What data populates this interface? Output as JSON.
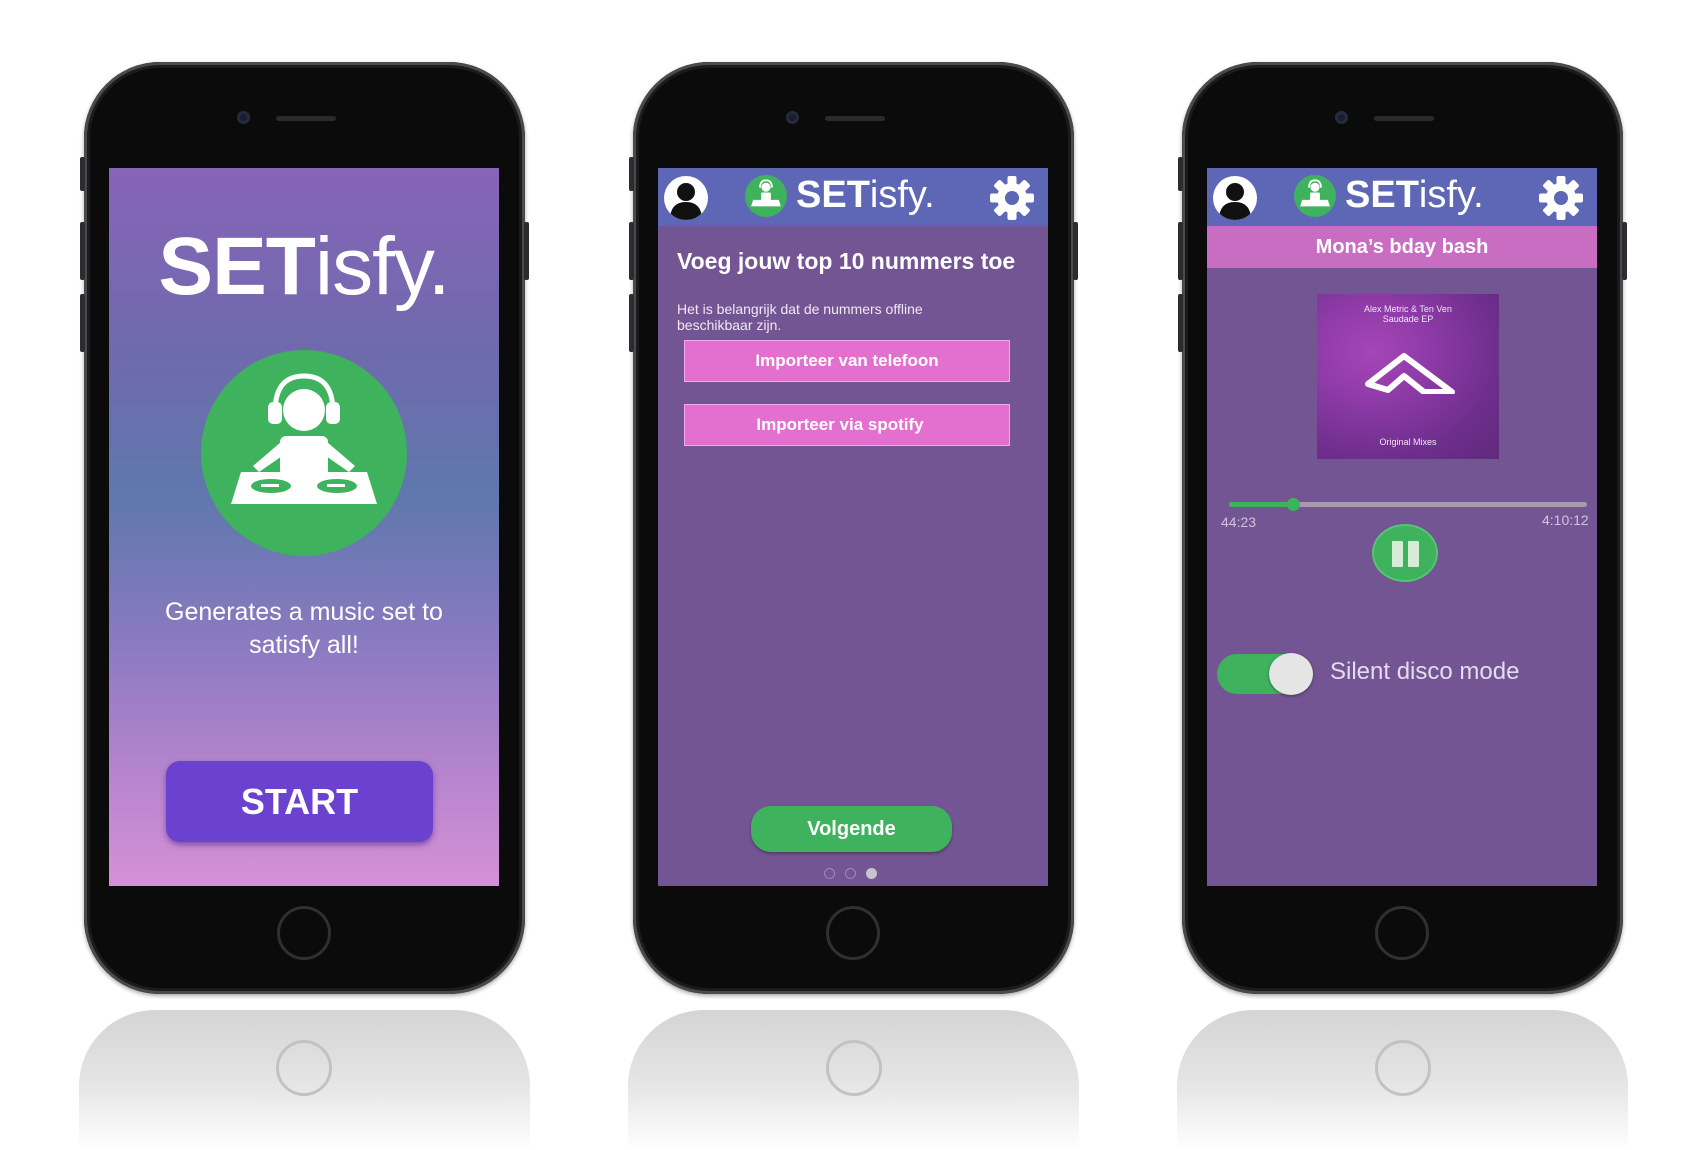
{
  "screen1": {
    "logo_bold": "SET",
    "logo_rest": "isfy.",
    "tagline_line1": "Generates a music set to",
    "tagline_line2": "satisfy all!",
    "start_label": "START"
  },
  "header": {
    "title_bold": "SET",
    "title_rest": "isfy."
  },
  "screen2": {
    "title": "Voeg jouw top 10 nummers toe",
    "subtitle": "Het is belangrijk dat de nummers offline beschikbaar zijn.",
    "import_phone_label": "Importeer van telefoon",
    "import_spotify_label": "Importeer via spotify",
    "next_label": "Volgende",
    "pager": {
      "total": 3,
      "active": 3
    }
  },
  "screen3": {
    "party_name": "Mona’s bday bash",
    "album": {
      "artist_line1": "Alex Metric & Ten Ven",
      "artist_line2": "Saudade EP",
      "footer": "Original Mixes"
    },
    "elapsed": "44:23",
    "total": "4:10:12",
    "progress_fraction": 0.18,
    "silent_disco_label": "Silent disco mode",
    "silent_disco_on": true
  },
  "colors": {
    "green": "#3fb25e",
    "purple": "#735594",
    "header_blue": "#5d67b5",
    "pink_button": "#e36fcf",
    "start_button": "#6a42cf",
    "party_bar": "#c86dc2"
  },
  "icons": [
    "dj-icon",
    "user-avatar-icon",
    "gear-icon",
    "pause-icon"
  ]
}
